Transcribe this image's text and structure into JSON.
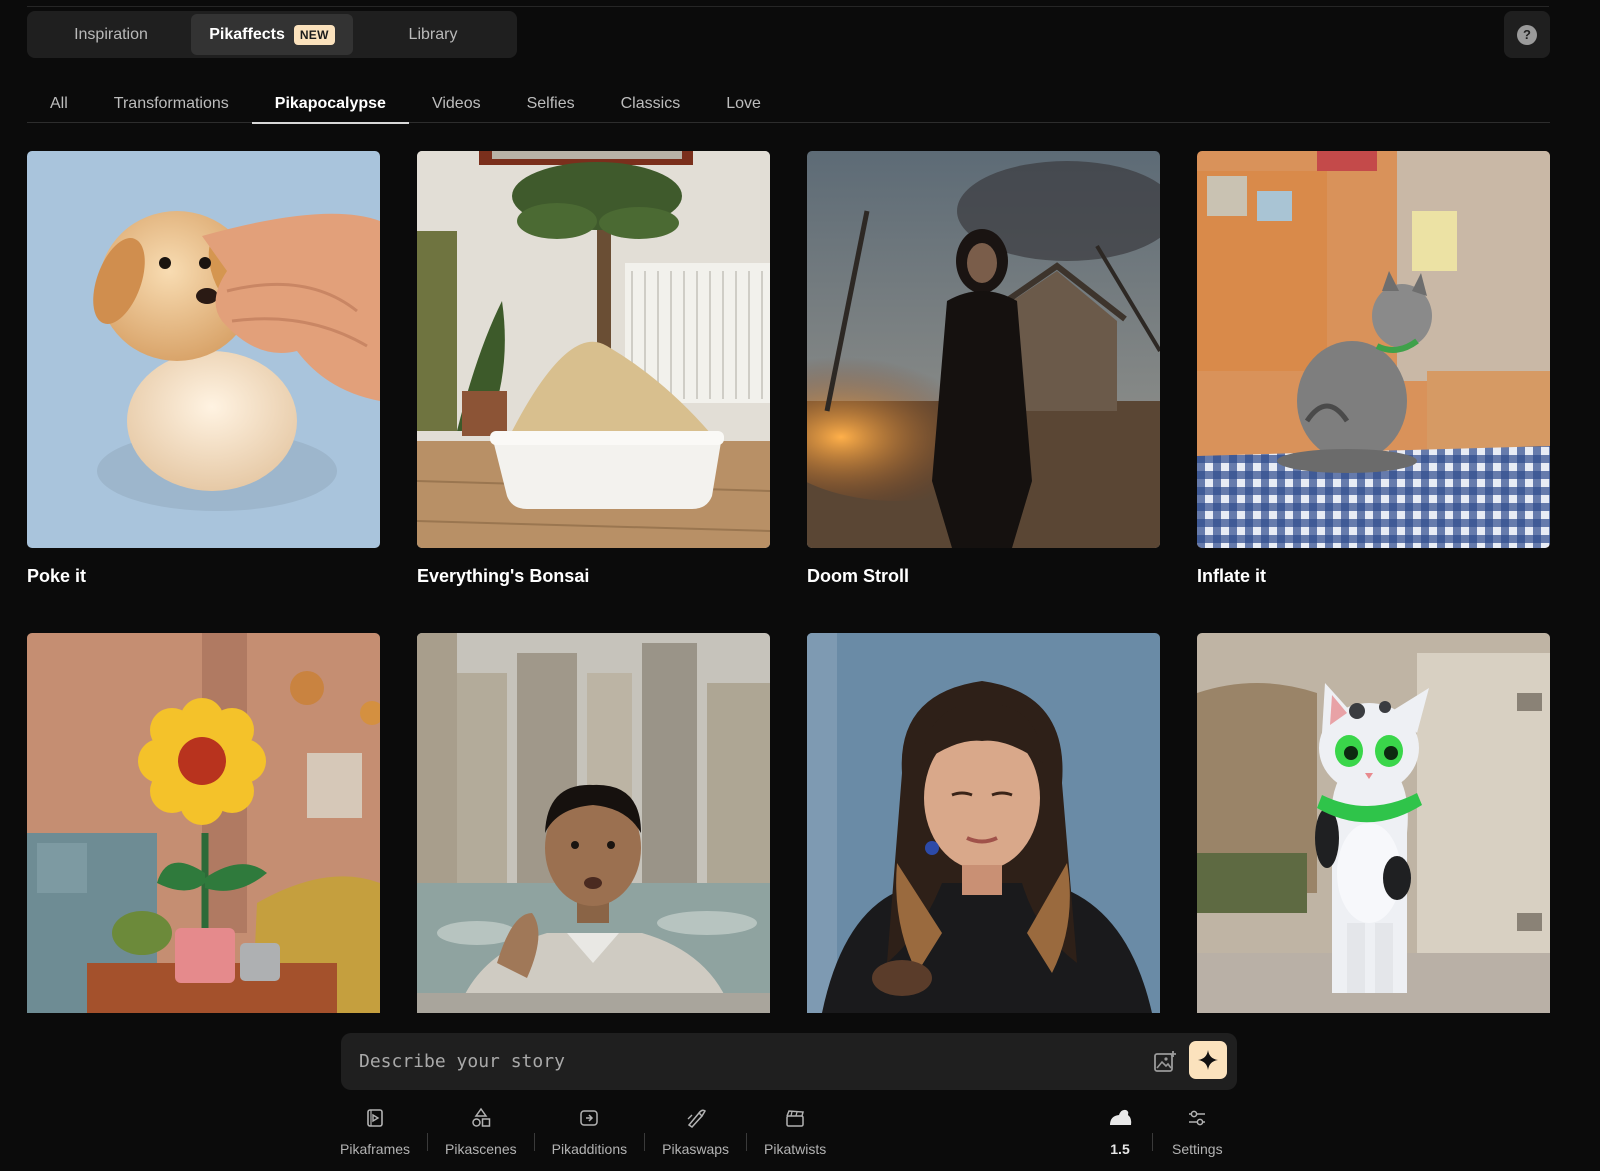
{
  "mode_tabs": [
    {
      "label": "Inspiration"
    },
    {
      "label": "Pikaffects",
      "badge": "NEW"
    },
    {
      "label": "Library"
    }
  ],
  "help": {
    "icon": "question-icon",
    "glyph": "?"
  },
  "category_tabs": [
    {
      "label": "All"
    },
    {
      "label": "Transformations"
    },
    {
      "label": "Pikapocalypse",
      "active": true
    },
    {
      "label": "Videos"
    },
    {
      "label": "Selfies"
    },
    {
      "label": "Classics"
    },
    {
      "label": "Love"
    }
  ],
  "effects": [
    {
      "title": "Poke it"
    },
    {
      "title": "Everything's Bonsai"
    },
    {
      "title": "Doom Stroll"
    },
    {
      "title": "Inflate it"
    },
    {
      "title": ""
    },
    {
      "title": ""
    },
    {
      "title": ""
    },
    {
      "title": ""
    }
  ],
  "prompt": {
    "placeholder": "Describe your story"
  },
  "tools": [
    {
      "label": "Pikaframes",
      "icon": "frames-icon"
    },
    {
      "label": "Pikascenes",
      "icon": "shapes-icon"
    },
    {
      "label": "Pikadditions",
      "icon": "additions-icon"
    },
    {
      "label": "Pikaswaps",
      "icon": "swap-brush-icon"
    },
    {
      "label": "Pikatwists",
      "icon": "clapper-icon"
    }
  ],
  "model": {
    "version": "1.5",
    "icon": "rabbit-icon"
  },
  "settings": {
    "label": "Settings",
    "icon": "sliders-icon"
  },
  "colors": {
    "background": "#0b0b0b",
    "panel": "#1f1f1f",
    "accent": "#fbe2bd"
  }
}
